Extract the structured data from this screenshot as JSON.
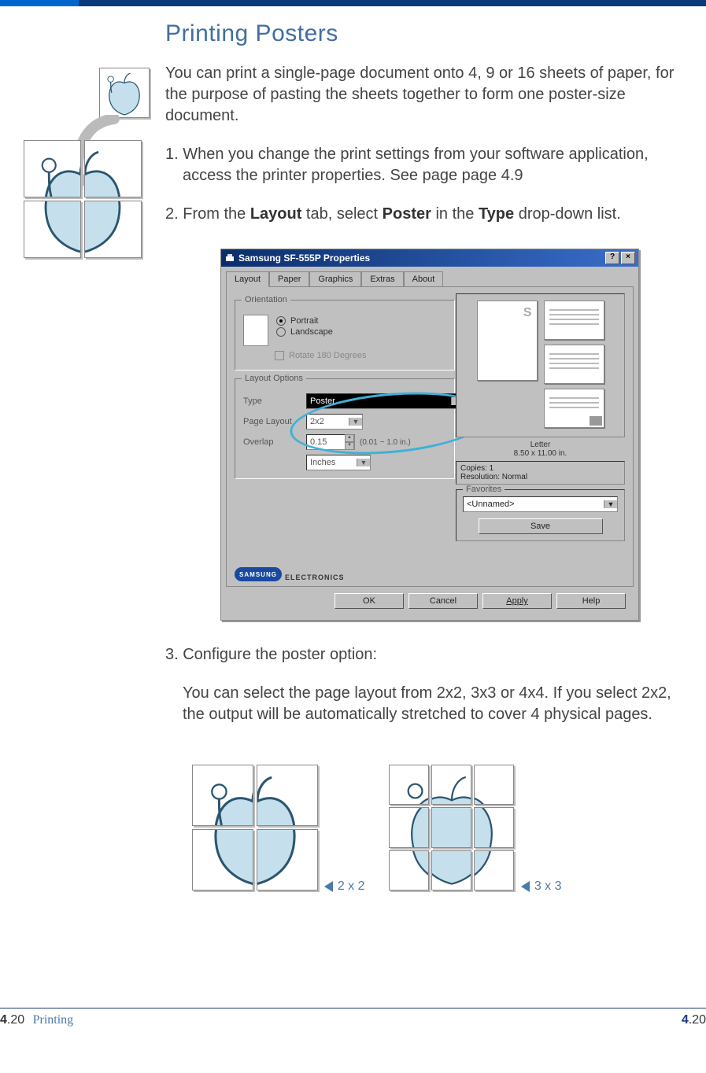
{
  "page": {
    "heading": "Printing Posters",
    "intro": "You can print a single-page document onto 4, 9 or 16 sheets of paper, for the purpose of pasting the sheets together to form one poster-size document.",
    "step1_a": "1. When you change the print settings from your software application,",
    "step1_b": "access the printer properties. See page page 4.9",
    "step2_a": "2. From the ",
    "step2_b": "Layout",
    "step2_c": " tab, select ",
    "step2_d": "Poster",
    "step2_e": " in the ",
    "step2_f": "Type",
    "step2_g": " drop-down list.",
    "step3": "3. Configure the poster option:",
    "step3_detail": "You can select the page layout from 2x2, 3x3 or 4x4. If you select 2x2, the output will be automatically stretched to cover 4 physical pages.",
    "label_2x2": "2 x 2",
    "label_3x3": "3 x 3"
  },
  "dialog": {
    "title": "Samsung SF-555P Properties",
    "help_btn": "?",
    "close_btn": "×",
    "tabs": [
      "Layout",
      "Paper",
      "Graphics",
      "Extras",
      "About"
    ],
    "orientation": {
      "label": "Orientation",
      "portrait": "Portrait",
      "landscape": "Landscape",
      "rotate": "Rotate 180 Degrees"
    },
    "layout_options": {
      "label": "Layout Options",
      "type_label": "Type",
      "type_value": "Poster",
      "page_layout_label": "Page Layout",
      "page_layout_value": "2x2",
      "overlap_label": "Overlap",
      "overlap_value": "0.15",
      "overlap_unit": "(0.01 ~ 1.0 in.)",
      "unit_value": "Inches"
    },
    "preview": {
      "mark": "S",
      "paper": "Letter",
      "size": "8.50 x 11.00 in.",
      "copies": "Copies: 1",
      "resolution": "Resolution: Normal"
    },
    "favorites": {
      "label": "Favorites",
      "value": "<Unnamed>",
      "save": "Save"
    },
    "brand": "SAMSUNG",
    "brand_sub": "ELECTRONICS",
    "buttons": {
      "ok": "OK",
      "cancel": "Cancel",
      "apply": "Apply",
      "help": "Help"
    }
  },
  "footer": {
    "page_num_bold": "4",
    "page_num_rest": ".20",
    "section": "Printing",
    "right_bold": "4",
    "right_rest": ".20"
  }
}
